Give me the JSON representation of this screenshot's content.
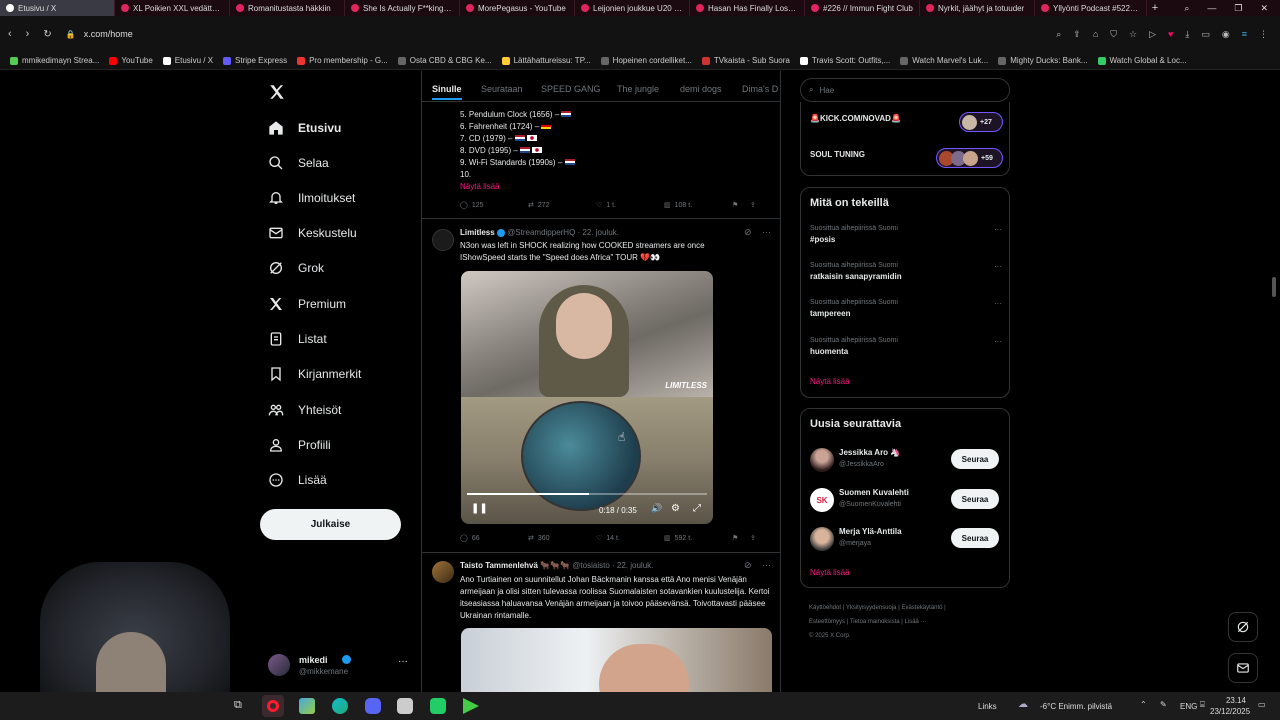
{
  "browser": {
    "tabs": [
      "Etusivu / X",
      "XL Poikien XXL vedättämi",
      "Romanitustasta häkkiin",
      "She Is Actually F**king De",
      "MorePegasus - YouTube",
      "Leijonien joukkue U20 MM",
      "Hasan Has Finally Lost His M",
      "#226 // Immun Fight Club",
      "Nyrkit, jäähyt ja totuuder",
      "Yllyönti Podcast #522, Ic"
    ],
    "url": "x.com/home",
    "bookmarks": [
      "mmikedimayn Strea...",
      "YouTube",
      "Etusivu / X",
      "Stripe Express",
      "Pro membership - G...",
      "Osta CBD & CBG Ke...",
      "Lättähattureissu: TP...",
      "Hopeinen cordelliket...",
      "TVkaista - Sub Suora",
      "Travis Scott: Outfits,...",
      "Watch Marvel's Luk...",
      "Mighty Ducks: Bank...",
      "Watch Global & Loc..."
    ]
  },
  "nav": {
    "items": [
      "Etusivu",
      "Selaa",
      "Ilmoitukset",
      "Keskustelu",
      "Grok",
      "Premium",
      "Listat",
      "Kirjanmerkit",
      "Yhteisöt",
      "Profiili",
      "Lisää"
    ],
    "post_button": "Julkaise",
    "account_name": "mikedi",
    "account_handle": "@mikkemane"
  },
  "feed": {
    "tabs": [
      "Sinulle",
      "Seurataan",
      "SPEED GANG",
      "The jungle",
      "demi dogs",
      "Dima's D"
    ],
    "list_lines": [
      "5. Pendulum Clock (1656) –",
      "6. Fahrenheit (1724) –",
      "7. CD (1979) –",
      "8. DVD (1995) –",
      "9. Wi-Fi Standards (1990s) –",
      "10."
    ],
    "show_more": "Näytä lisää",
    "post0_stats": {
      "replies": "125",
      "reposts": "272",
      "likes": "1 t.",
      "views": "108 t."
    },
    "post1": {
      "name": "Limitless",
      "handle": "@StreamdipperHQ · 22. jouluk.",
      "text": "N3on was left in SHOCK realizing how COOKED streamers are once IShowSpeed starts the \"Speed does Africa\" TOUR",
      "watermark": "LIMITLESS",
      "video_time": "0:18 / 0:35",
      "progress": 0.51,
      "stats": {
        "replies": "66",
        "reposts": "360",
        "likes": "14 t.",
        "views": "592 t."
      }
    },
    "post2": {
      "name": "Taisto Tammenlehvä",
      "handle": "@tosiaisto · 22. jouluk.",
      "text": "Ano Turtiainen on suunnitellut Johan Bäckmanin kanssa että Ano menisi Venäjän armeijaan ja olisi sitten tulevassa roolissa Suomalaisten sotavankien kuulustelija. Kertoi itseasiassa haluavansa Venäjän armeijaan ja toivoo pääsevänsä. Toivottavasti pääsee Ukrainan rintamalle."
    }
  },
  "right": {
    "search_placeholder": "Hae",
    "spaces": [
      {
        "name": "KICK.COM/NOVAD",
        "count": "+27"
      },
      {
        "name": "SOUL TUNING",
        "count": "+59"
      }
    ],
    "trending_title": "Mitä on tekeillä",
    "trending_context": "Suosittua aihepiirissä Suomi",
    "trends": [
      "#posis",
      "ratkaisin sanapyramidin",
      "tampereen",
      "huomenta"
    ],
    "trending_more": "Näytä lisää",
    "who_title": "Uusia seurattavia",
    "who": [
      {
        "name": "Jessikka Aro",
        "handle": "@JessikkaAro",
        "initials": ""
      },
      {
        "name": "Suomen Kuvalehti",
        "handle": "@SuomenKuvalehti",
        "initials": "SK"
      },
      {
        "name": "Merja Ylä-Anttila",
        "handle": "@merjaya",
        "initials": ""
      }
    ],
    "follow_label": "Seuraa",
    "who_more": "Näytä lisää",
    "footer": [
      "Käyttöehdot",
      "Yksityisyydensuoja",
      "Evästekäytäntö",
      "Esteettömyys",
      "Tietoa mainoksista",
      "Lisää ···",
      "© 2025 X Corp."
    ]
  },
  "taskbar": {
    "links": "Links",
    "weather": "-6°C  Enimm. pilvistä",
    "lang": "ENG",
    "time": "23.14",
    "date": "23/12/2025"
  }
}
